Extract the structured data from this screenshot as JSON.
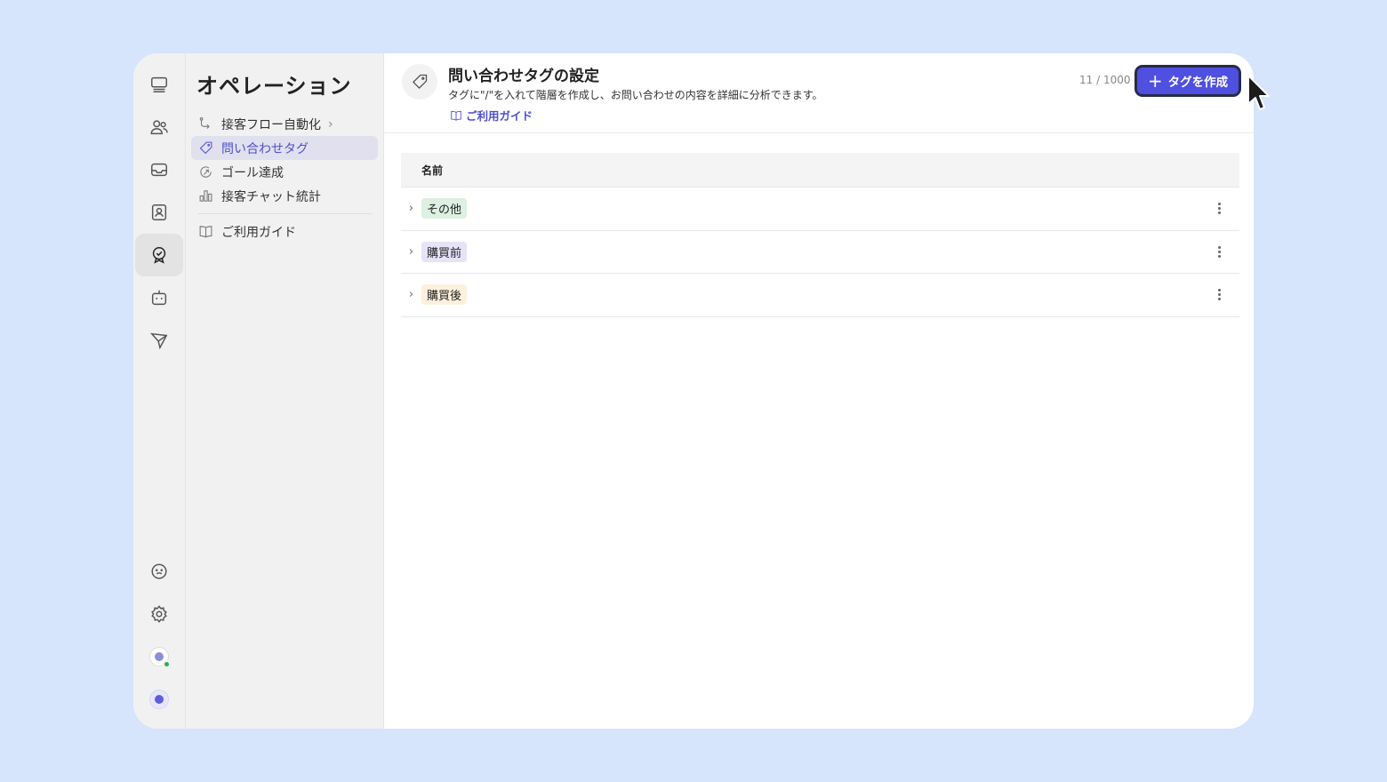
{
  "rail": {
    "top_icons": [
      "monitor-icon",
      "users-icon",
      "inbox-icon",
      "contacts-icon",
      "badge-check-icon",
      "bot-icon",
      "send-icon"
    ],
    "active": "badge-check-icon",
    "bottom_icons": [
      "support-icon",
      "gear-icon",
      "user-avatar",
      "bot-avatar"
    ]
  },
  "subnav": {
    "title": "オペレーション",
    "items": [
      {
        "label": "接客フロー自動化",
        "icon": "flow-icon"
      },
      {
        "label": "問い合わせタグ",
        "icon": "tag-icon"
      },
      {
        "label": "ゴール達成",
        "icon": "goal-icon"
      },
      {
        "label": "接客チャット統計",
        "icon": "bar-chart-icon"
      }
    ],
    "guide": {
      "label": "ご利用ガイド",
      "icon": "book-icon"
    }
  },
  "header": {
    "title": "問い合わせタグの設定",
    "description": "タグに\"/\"を入れて階層を作成し、お問い合わせの内容を詳細に分析できます。",
    "guide_link": "ご利用ガイド",
    "count": "11 / 1000",
    "create_button": "タグを作成"
  },
  "table": {
    "column_name": "名前",
    "rows": [
      {
        "tag": "その他",
        "color": "#ddf0e2"
      },
      {
        "tag": "購買前",
        "color": "#e6e3f8"
      },
      {
        "tag": "購買後",
        "color": "#fdf0dc"
      }
    ]
  },
  "colors": {
    "accent": "#4f4fe0",
    "background": "#d6e4fc"
  }
}
